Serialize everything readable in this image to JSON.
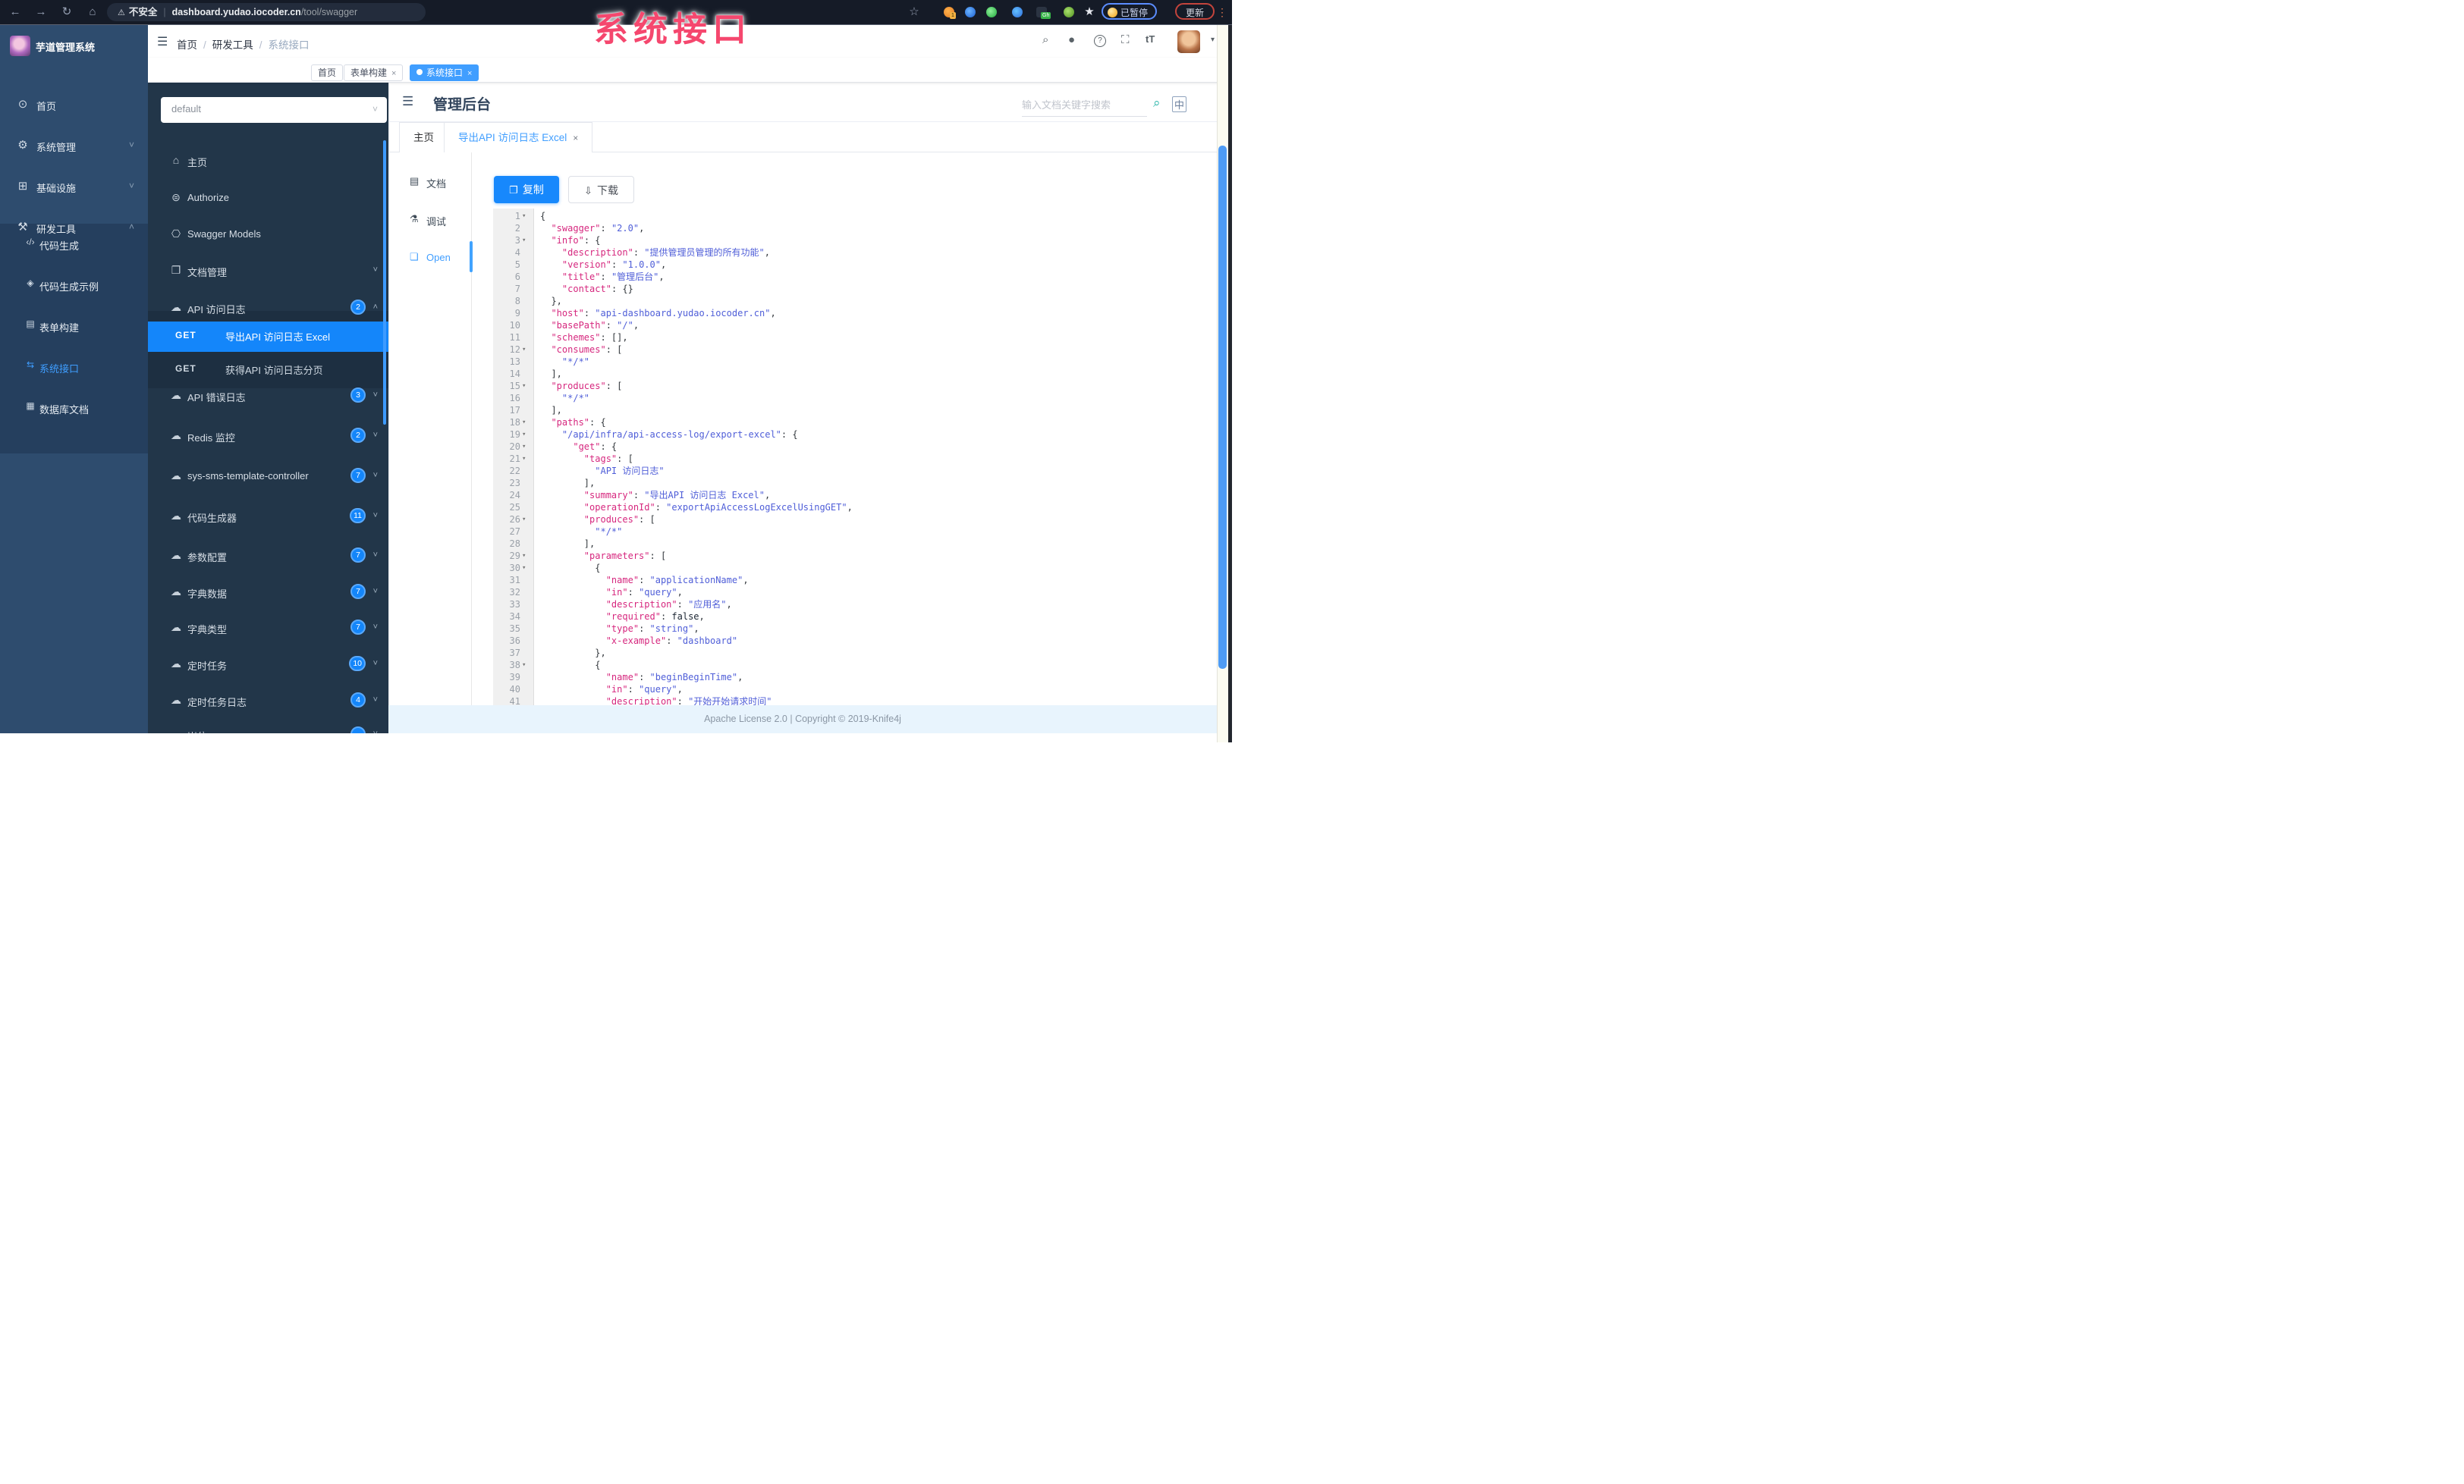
{
  "browser": {
    "security_label": "不安全",
    "url_domain": "dashboard.yudao.iocoder.cn",
    "url_path": "/tool/swagger",
    "paused_label": "已暂停",
    "update_label": "更新",
    "ext_badge_1": "1",
    "ext_badge_gh": "Gh"
  },
  "watermark": "系统接口",
  "colors": {
    "accent": "#409EFF",
    "endpoint_selected": "#1486fa",
    "sidebar_bg": "#2e4c6e",
    "api_sidebar_bg": "#223649",
    "watermark": "#f5476e",
    "code_key": "#d6277e",
    "code_string": "#4f5ed8"
  },
  "sidebar": {
    "logo_title": "芋道管理系统",
    "items": [
      {
        "label": "首页",
        "icon": "dashboard-icon"
      },
      {
        "label": "系统管理",
        "icon": "gear-icon",
        "chevron": "down"
      },
      {
        "label": "基础设施",
        "icon": "infra-icon",
        "chevron": "down"
      },
      {
        "label": "研发工具",
        "icon": "tools-icon",
        "chevron": "up"
      }
    ],
    "subitems": [
      {
        "label": "代码生成",
        "icon": "code-icon"
      },
      {
        "label": "代码生成示例",
        "icon": "shield-icon"
      },
      {
        "label": "表单构建",
        "icon": "form-icon"
      },
      {
        "label": "系统接口",
        "icon": "api-icon",
        "selected": true
      },
      {
        "label": "数据库文档",
        "icon": "db-icon"
      }
    ]
  },
  "navbar": {
    "breadcrumb": [
      "首页",
      "研发工具",
      "系统接口"
    ],
    "tags": [
      {
        "label": "首页"
      },
      {
        "label": "表单构建",
        "closable": true
      },
      {
        "label": "系统接口",
        "closable": true,
        "active": true
      }
    ]
  },
  "api_sidebar": {
    "group_select_value": "default",
    "items": [
      {
        "label": "主页",
        "icon": "home-icon"
      },
      {
        "label": "Authorize",
        "icon": "auth-icon"
      },
      {
        "label": "Swagger Models",
        "icon": "models-icon"
      },
      {
        "label": "文档管理",
        "icon": "docmgmt-icon",
        "chevron": "down"
      },
      {
        "label": "API 访问日志",
        "icon": "cloud-icon",
        "badge": "2",
        "chevron": "up"
      }
    ],
    "endpoints": [
      {
        "method": "GET",
        "label": "导出API 访问日志 Excel",
        "selected": true
      },
      {
        "method": "GET",
        "label": "获得API 访问日志分页"
      }
    ],
    "groups": [
      {
        "label": "API 错误日志",
        "badge": "3"
      },
      {
        "label": "Redis 监控",
        "badge": "2"
      },
      {
        "label": "sys-sms-template-controller",
        "badge": "7"
      },
      {
        "label": "代码生成器",
        "badge": "11"
      },
      {
        "label": "参数配置",
        "badge": "7"
      },
      {
        "label": "字典数据",
        "badge": "7"
      },
      {
        "label": "字典类型",
        "badge": "7"
      },
      {
        "label": "定时任务",
        "badge": "10"
      },
      {
        "label": "定时任务日志",
        "badge": "4"
      },
      {
        "label": "岗位",
        "badge": ""
      }
    ]
  },
  "main": {
    "title": "管理后台",
    "search_placeholder": "输入文档关键字搜索",
    "lang_label": "中",
    "tabs": [
      {
        "label": "主页"
      },
      {
        "label": "导出API 访问日志 Excel",
        "closable": true,
        "active": true
      }
    ],
    "doc_nav": [
      {
        "label": "文档",
        "icon": "doc-icon"
      },
      {
        "label": "调试",
        "icon": "debug-icon"
      },
      {
        "label": "Open",
        "icon": "open-icon",
        "active": true
      }
    ],
    "copy_button": "复制",
    "download_button": "下载",
    "footer": "Apache License 2.0 | Copyright © 2019-Knife4j"
  },
  "code": {
    "lines": [
      {
        "n": 1,
        "fold": true,
        "parts": [
          [
            "p",
            "{"
          ]
        ]
      },
      {
        "n": 2,
        "parts": [
          [
            "p",
            "  "
          ],
          [
            "k",
            "\"swagger\""
          ],
          [
            "p",
            ": "
          ],
          [
            "s",
            "\"2.0\""
          ],
          [
            "p",
            ","
          ]
        ]
      },
      {
        "n": 3,
        "fold": true,
        "parts": [
          [
            "p",
            "  "
          ],
          [
            "k",
            "\"info\""
          ],
          [
            "p",
            ": {"
          ]
        ]
      },
      {
        "n": 4,
        "parts": [
          [
            "p",
            "    "
          ],
          [
            "k",
            "\"description\""
          ],
          [
            "p",
            ": "
          ],
          [
            "s",
            "\"提供管理员管理的所有功能\""
          ],
          [
            "p",
            ","
          ]
        ]
      },
      {
        "n": 5,
        "parts": [
          [
            "p",
            "    "
          ],
          [
            "k",
            "\"version\""
          ],
          [
            "p",
            ": "
          ],
          [
            "s",
            "\"1.0.0\""
          ],
          [
            "p",
            ","
          ]
        ]
      },
      {
        "n": 6,
        "parts": [
          [
            "p",
            "    "
          ],
          [
            "k",
            "\"title\""
          ],
          [
            "p",
            ": "
          ],
          [
            "s",
            "\"管理后台\""
          ],
          [
            "p",
            ","
          ]
        ]
      },
      {
        "n": 7,
        "parts": [
          [
            "p",
            "    "
          ],
          [
            "k",
            "\"contact\""
          ],
          [
            "p",
            ": {}"
          ]
        ]
      },
      {
        "n": 8,
        "parts": [
          [
            "p",
            "  },"
          ]
        ]
      },
      {
        "n": 9,
        "parts": [
          [
            "p",
            "  "
          ],
          [
            "k",
            "\"host\""
          ],
          [
            "p",
            ": "
          ],
          [
            "s",
            "\"api-dashboard.yudao.iocoder.cn\""
          ],
          [
            "p",
            ","
          ]
        ]
      },
      {
        "n": 10,
        "parts": [
          [
            "p",
            "  "
          ],
          [
            "k",
            "\"basePath\""
          ],
          [
            "p",
            ": "
          ],
          [
            "s",
            "\"/\""
          ],
          [
            "p",
            ","
          ]
        ]
      },
      {
        "n": 11,
        "parts": [
          [
            "p",
            "  "
          ],
          [
            "k",
            "\"schemes\""
          ],
          [
            "p",
            ": [],"
          ]
        ]
      },
      {
        "n": 12,
        "fold": true,
        "parts": [
          [
            "p",
            "  "
          ],
          [
            "k",
            "\"consumes\""
          ],
          [
            "p",
            ": ["
          ]
        ]
      },
      {
        "n": 13,
        "parts": [
          [
            "p",
            "    "
          ],
          [
            "s",
            "\"*/*\""
          ]
        ]
      },
      {
        "n": 14,
        "parts": [
          [
            "p",
            "  ],"
          ]
        ]
      },
      {
        "n": 15,
        "fold": true,
        "parts": [
          [
            "p",
            "  "
          ],
          [
            "k",
            "\"produces\""
          ],
          [
            "p",
            ": ["
          ]
        ]
      },
      {
        "n": 16,
        "parts": [
          [
            "p",
            "    "
          ],
          [
            "s",
            "\"*/*\""
          ]
        ]
      },
      {
        "n": 17,
        "parts": [
          [
            "p",
            "  ],"
          ]
        ]
      },
      {
        "n": 18,
        "fold": true,
        "parts": [
          [
            "p",
            "  "
          ],
          [
            "k",
            "\"paths\""
          ],
          [
            "p",
            ": {"
          ]
        ]
      },
      {
        "n": 19,
        "fold": true,
        "parts": [
          [
            "p",
            "    "
          ],
          [
            "s",
            "\"/api/infra/api-access-log/export-excel\""
          ],
          [
            "p",
            ": {"
          ]
        ]
      },
      {
        "n": 20,
        "fold": true,
        "parts": [
          [
            "p",
            "      "
          ],
          [
            "k",
            "\"get\""
          ],
          [
            "p",
            ": {"
          ]
        ]
      },
      {
        "n": 21,
        "fold": true,
        "parts": [
          [
            "p",
            "        "
          ],
          [
            "k",
            "\"tags\""
          ],
          [
            "p",
            ": ["
          ]
        ]
      },
      {
        "n": 22,
        "parts": [
          [
            "p",
            "          "
          ],
          [
            "s",
            "\"API 访问日志\""
          ]
        ]
      },
      {
        "n": 23,
        "parts": [
          [
            "p",
            "        ],"
          ]
        ]
      },
      {
        "n": 24,
        "parts": [
          [
            "p",
            "        "
          ],
          [
            "k",
            "\"summary\""
          ],
          [
            "p",
            ": "
          ],
          [
            "s",
            "\"导出API 访问日志 Excel\""
          ],
          [
            "p",
            ","
          ]
        ]
      },
      {
        "n": 25,
        "parts": [
          [
            "p",
            "        "
          ],
          [
            "k",
            "\"operationId\""
          ],
          [
            "p",
            ": "
          ],
          [
            "s",
            "\"exportApiAccessLogExcelUsingGET\""
          ],
          [
            "p",
            ","
          ]
        ]
      },
      {
        "n": 26,
        "fold": true,
        "parts": [
          [
            "p",
            "        "
          ],
          [
            "k",
            "\"produces\""
          ],
          [
            "p",
            ": ["
          ]
        ]
      },
      {
        "n": 27,
        "parts": [
          [
            "p",
            "          "
          ],
          [
            "s",
            "\"*/*\""
          ]
        ]
      },
      {
        "n": 28,
        "parts": [
          [
            "p",
            "        ],"
          ]
        ]
      },
      {
        "n": 29,
        "fold": true,
        "parts": [
          [
            "p",
            "        "
          ],
          [
            "k",
            "\"parameters\""
          ],
          [
            "p",
            ": ["
          ]
        ]
      },
      {
        "n": 30,
        "fold": true,
        "parts": [
          [
            "p",
            "          {"
          ]
        ]
      },
      {
        "n": 31,
        "parts": [
          [
            "p",
            "            "
          ],
          [
            "k",
            "\"name\""
          ],
          [
            "p",
            ": "
          ],
          [
            "s",
            "\"applicationName\""
          ],
          [
            "p",
            ","
          ]
        ]
      },
      {
        "n": 32,
        "parts": [
          [
            "p",
            "            "
          ],
          [
            "k",
            "\"in\""
          ],
          [
            "p",
            ": "
          ],
          [
            "s",
            "\"query\""
          ],
          [
            "p",
            ","
          ]
        ]
      },
      {
        "n": 33,
        "parts": [
          [
            "p",
            "            "
          ],
          [
            "k",
            "\"description\""
          ],
          [
            "p",
            ": "
          ],
          [
            "s",
            "\"应用名\""
          ],
          [
            "p",
            ","
          ]
        ]
      },
      {
        "n": 34,
        "parts": [
          [
            "p",
            "            "
          ],
          [
            "k",
            "\"required\""
          ],
          [
            "p",
            ": "
          ],
          [
            "b",
            "false"
          ],
          [
            "p",
            ","
          ]
        ]
      },
      {
        "n": 35,
        "parts": [
          [
            "p",
            "            "
          ],
          [
            "k",
            "\"type\""
          ],
          [
            "p",
            ": "
          ],
          [
            "s",
            "\"string\""
          ],
          [
            "p",
            ","
          ]
        ]
      },
      {
        "n": 36,
        "parts": [
          [
            "p",
            "            "
          ],
          [
            "k",
            "\"x-example\""
          ],
          [
            "p",
            ": "
          ],
          [
            "s",
            "\"dashboard\""
          ]
        ]
      },
      {
        "n": 37,
        "parts": [
          [
            "p",
            "          },"
          ]
        ]
      },
      {
        "n": 38,
        "fold": true,
        "parts": [
          [
            "p",
            "          {"
          ]
        ]
      },
      {
        "n": 39,
        "parts": [
          [
            "p",
            "            "
          ],
          [
            "k",
            "\"name\""
          ],
          [
            "p",
            ": "
          ],
          [
            "s",
            "\"beginBeginTime\""
          ],
          [
            "p",
            ","
          ]
        ]
      },
      {
        "n": 40,
        "parts": [
          [
            "p",
            "            "
          ],
          [
            "k",
            "\"in\""
          ],
          [
            "p",
            ": "
          ],
          [
            "s",
            "\"query\""
          ],
          [
            "p",
            ","
          ]
        ]
      },
      {
        "n": 41,
        "parts": [
          [
            "p",
            "            "
          ],
          [
            "k",
            "\"description\""
          ],
          [
            "p",
            ": "
          ],
          [
            "s",
            "\"开始开始请求时间\""
          ]
        ]
      }
    ]
  }
}
